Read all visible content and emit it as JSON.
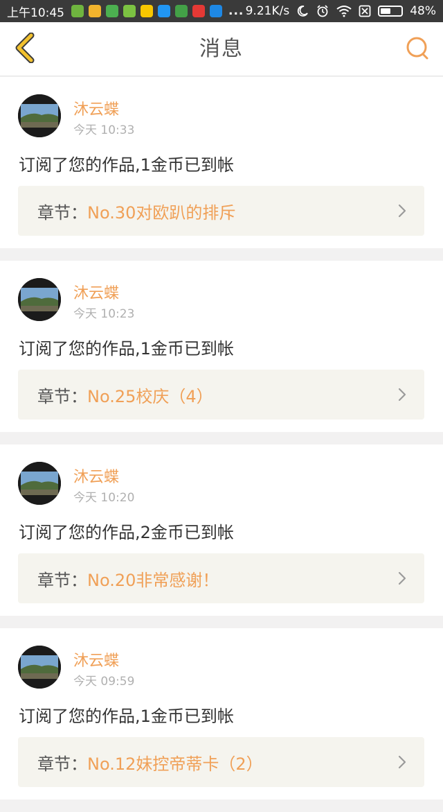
{
  "status_bar": {
    "time": "上午10:45",
    "app_icons": [
      {
        "name": "plant-app-icon",
        "color": "#6fb43f"
      },
      {
        "name": "qr-app-icon",
        "color": "#f2b42d"
      },
      {
        "name": "book-app-icon",
        "color": "#4caf50"
      },
      {
        "name": "chat-app-icon",
        "color": "#7cc242"
      },
      {
        "name": "taxi-app-icon",
        "color": "#f7c600"
      },
      {
        "name": "browser-app-icon",
        "color": "#2196f3"
      },
      {
        "name": "ebook-app-icon",
        "color": "#43a047"
      },
      {
        "name": "news-app-icon",
        "color": "#e53935"
      },
      {
        "name": "browser2-app-icon",
        "color": "#1e88e5"
      }
    ],
    "more": "...",
    "network_speed": "9.21K/s",
    "battery_percent": "48%",
    "battery_level": 0.48
  },
  "nav": {
    "title": "消息"
  },
  "messages": [
    {
      "username": "沐云蝶",
      "time": "今天 10:33",
      "text": "订阅了您的作品,1金币已到帐",
      "chapter_label": "章节：",
      "chapter_title": "No.30对欧趴的排斥"
    },
    {
      "username": "沐云蝶",
      "time": "今天 10:23",
      "text": "订阅了您的作品,1金币已到帐",
      "chapter_label": "章节：",
      "chapter_title": "No.25校庆（4）"
    },
    {
      "username": "沐云蝶",
      "time": "今天 10:20",
      "text": "订阅了您的作品,2金币已到帐",
      "chapter_label": "章节：",
      "chapter_title": "No.20非常感谢！"
    },
    {
      "username": "沐云蝶",
      "time": "今天 09:59",
      "text": "订阅了您的作品,1金币已到帐",
      "chapter_label": "章节：",
      "chapter_title": "No.12妹控帝蒂卡（2）"
    }
  ],
  "colors": {
    "accent": "#f0a057",
    "back_icon": "#f2c12e",
    "chapter_bg": "#f5f4ee"
  }
}
